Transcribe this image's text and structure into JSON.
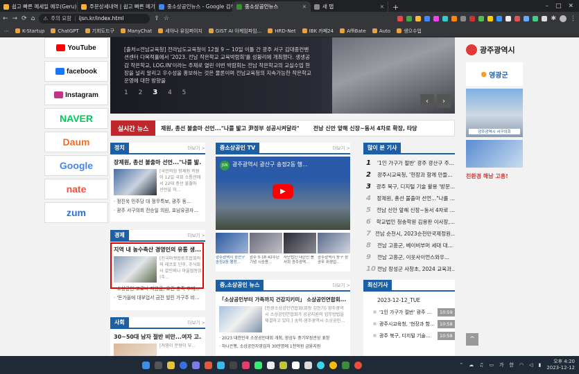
{
  "browser": {
    "tabs": [
      {
        "title": "쉽고 빠른 메세일 예우(Geru)",
        "color": "#f3b233"
      },
      {
        "title": "주문상세내역 | 쉽고 빠른 메가!",
        "color": "#f3b233"
      },
      {
        "title": "중소상공인뉴스 - Google 검색",
        "color": "#4285f4"
      },
      {
        "title": "중소상공인뉴스",
        "color": "#3a8c3a",
        "active": true
      },
      {
        "title": "새 탭",
        "color": "#888888"
      }
    ],
    "new_tab": "+",
    "window_controls": [
      "–",
      "□",
      "✕"
    ],
    "security": "주의 요함",
    "url": "ijsn.kr/index.html",
    "bookmarks": [
      "K-Startup",
      "ChatGPT",
      "기회도드구",
      "ManyChat",
      "세아나 유임퍼이지",
      "GIST AI 아케임파임...",
      "HRD-Net",
      "IBK 카페24",
      "AffiBate",
      "Auto",
      "생으수업"
    ]
  },
  "left_sns": [
    {
      "label": "YouTube",
      "color": "#ff0000",
      "icon": "youtube-icon"
    },
    {
      "label": "facebook",
      "color": "#1877f2",
      "icon": "facebook-icon"
    },
    {
      "label": "Instagram",
      "color": "#c13584",
      "icon": "instagram-icon"
    },
    {
      "label": "NAVER",
      "color": "#03c75a",
      "icon": ""
    },
    {
      "label": "Daum",
      "color": "#f26a22",
      "icon": ""
    },
    {
      "label": "Google",
      "color": "#4285f4",
      "icon": ""
    },
    {
      "label": "nate",
      "color": "#ff4b3a",
      "icon": ""
    },
    {
      "label": "zum",
      "color": "#2a6fdb",
      "icon": ""
    }
  ],
  "hero": {
    "text": "[출처=전남교육청] 전라남도교육청이 12월 9 ~ 10일 이틀 간 광주 서구 김대중컨벤션센터 다목적홀에서 '2023. 전남 작은학교 교육박람회'를 성황리에 개최했다. 생생공감 작은학교, LOG.IN'이라는 주제로 열린 이번 박람회는 전남 작은학교의 교실수업 현장을 널리 알리고 우수성을 홍보하는 것은 물론이며 전남교육청의 지속가능한 작은학교 운영에 대한 방향을",
    "pages": [
      "1",
      "2",
      "3",
      "4",
      "5"
    ],
    "current_page": "3",
    "prev": "‹",
    "next": "›"
  },
  "ticker": {
    "label": "실시간 뉴스",
    "items": [
      "제원, 총선 불출마 선언...\"나를 밟고 尹정부 성공시켜달라\"",
      "전남 신안 앞해 신장~동서 4차로 확장, 타당"
    ]
  },
  "politics": {
    "title": "정치",
    "more": "더보기 >",
    "headline": "장제원, 총선 불출마 선언...\"나를 밟...",
    "summary": "[국민의힘 장제원 의원이 12일 국회 소통관에서 22대 총선 불출마 선언을 하...",
    "items": [
      "· 정진욱 민주당 대 정무특보, 광주 동...",
      "· 광주 서구의회 전승일 의원, 효남유권자..."
    ]
  },
  "economy": {
    "title": "경제",
    "more": "더보기 >",
    "headline": "지역 내 농수축산 경영인의 유통 생...",
    "summary": "[친국마켓협동조합회의의 레코포 단후, 주식회사 갈인외나 마을협동임(주...",
    "items": [
      "· 소상공인 코로나 지원금, 요건 충족 후에...",
      "· '돈가을에 대부업서 금전 빌린 가구주 비..."
    ]
  },
  "society": {
    "title": "사회",
    "more": "더보기 >",
    "headline": "30~50대 남자 절반 비만...여자 고...",
    "summary": "[저영이 문형이 부..."
  },
  "tv": {
    "title": "중소상공인 TV",
    "more": "더보기 >",
    "video_title": "광주광역시 광산구 송정2동 행...",
    "channel": "JSN",
    "play": "▶",
    "gallery": [
      "광주광역시 광산구 송정2동 행정...",
      "광주 5·18 42주년 기념 시승용...",
      "사단법인 대한민 봉사회 광주광역...",
      "광주광역시 동구 청 공무 위생업..."
    ]
  },
  "sme_news": {
    "title": "중,소상공인 뉴스",
    "more": "더보기 >",
    "headline": "「소상공인부터 가족까지 건강지키미」 소상공인연합회...",
    "summary": "[인광소상공인연합회(회장 김인기) 광주광역시 소상공인연합회가 공공지원의 업무방법을 체결하고 있다.] 송학-광주광역시 소상공인...",
    "items": [
      "· 2023 대한민국 소상공인대회 개최, 장상두 중기부장관상 표창",
      "· 하나은행, 소상공인자영업자 30만명에 1천억원 금융지원"
    ]
  },
  "popular": {
    "title": "많이 본 기사",
    "items": [
      {
        "rank": "1",
        "text": "'1인 가구가 절반' 광주 광산구 주..."
      },
      {
        "rank": "2",
        "text": "광주시교육청, '현장과 함께 만들..."
      },
      {
        "rank": "3",
        "text": "광주 북구, 디지털 기술 활용 '방문..."
      },
      {
        "rank": "4",
        "text": "장제원, 총선 불출마 선언...\"나를 ..."
      },
      {
        "rank": "5",
        "text": "전남 신안 앞해 신장~동서 4차로 ..."
      },
      {
        "rank": "6",
        "text": "학교법인 청송학원 김용판 이사장,..."
      },
      {
        "rank": "7",
        "text": "전남 순천시, 2023순천만국제정원..."
      },
      {
        "rank": "8",
        "text": "전남 고흥군, 베이비부머 세대 대..."
      },
      {
        "rank": "9",
        "text": "전남 고흥군, 이웃사이언스와우..."
      },
      {
        "rank": "10",
        "text": "전남 장성군 사창초, 2024 교육과..."
      }
    ]
  },
  "latest": {
    "title": "최신기사",
    "date": "2023-12-12_TUE",
    "items": [
      {
        "text": "'1인 가구가 절반' 광주 ...",
        "time": "10:59"
      },
      {
        "text": "광주시교육청, '현장과 함...",
        "time": "10:58"
      },
      {
        "text": "광주 북구, 디지털 기술...",
        "time": "10:58"
      }
    ]
  },
  "right_banners": {
    "gwangju": "광주광역시",
    "yeonggwang": "영광군",
    "seogu": "광주광역시 서구의회",
    "slogan": "친환경 해남 고흥!"
  },
  "top_button": "^",
  "taskbar": {
    "ime": "가",
    "ime2": "한",
    "time": "오후 4:20",
    "date": "2023-12-12"
  },
  "colors": {
    "accent": "#1d5fa5",
    "ticker": "#c0272d",
    "highlight": "#e00000"
  }
}
